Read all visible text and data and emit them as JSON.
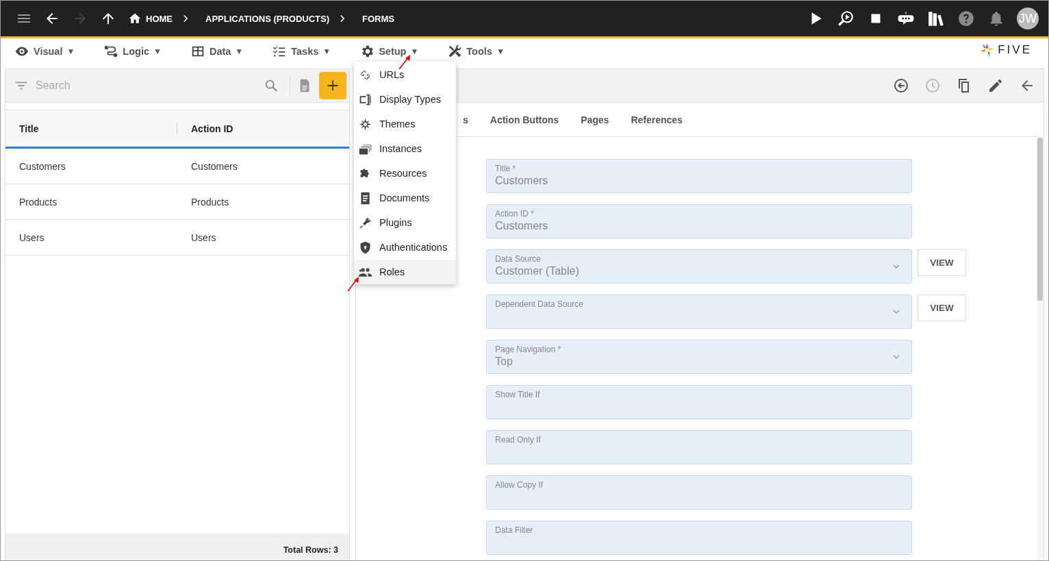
{
  "top_bar": {
    "breadcrumbs": [
      "HOME",
      "APPLICATIONS (PRODUCTS)",
      "FORMS"
    ],
    "avatar": "JW"
  },
  "menu_bar": {
    "items": [
      {
        "label": "Visual",
        "caret": "▼",
        "kind": "eye"
      },
      {
        "label": "Logic",
        "caret": "▼",
        "kind": "flow"
      },
      {
        "label": "Data",
        "caret": "▼",
        "kind": "table"
      },
      {
        "label": "Tasks",
        "caret": "▼",
        "kind": "tasks"
      },
      {
        "label": "Setup",
        "caret": "▼",
        "kind": "gear"
      },
      {
        "label": "Tools",
        "caret": "▼",
        "kind": "tools"
      }
    ],
    "logo": "FIVE"
  },
  "setup_menu": [
    {
      "label": "URLs",
      "kind": "link",
      "selected": false
    },
    {
      "label": "Display Types",
      "kind": "display",
      "selected": false
    },
    {
      "label": "Themes",
      "kind": "themes",
      "selected": false
    },
    {
      "label": "Instances",
      "kind": "instances",
      "selected": false
    },
    {
      "label": "Resources",
      "kind": "puzzle",
      "selected": false
    },
    {
      "label": "Documents",
      "kind": "document",
      "selected": false
    },
    {
      "label": "Plugins",
      "kind": "plug",
      "selected": false
    },
    {
      "label": "Authentications",
      "kind": "shield",
      "selected": false
    },
    {
      "label": "Roles",
      "kind": "people",
      "selected": true
    }
  ],
  "list_panel": {
    "search": {
      "placeholder": "Search"
    },
    "columns": [
      "Title",
      "Action ID"
    ],
    "rows": [
      [
        "Customers",
        "Customers"
      ],
      [
        "Products",
        "Products"
      ],
      [
        "Users",
        "Users"
      ]
    ],
    "footer": "Total Rows: 3"
  },
  "detail_panel": {
    "tabs": [
      "s",
      "Action Buttons",
      "Pages",
      "References"
    ],
    "fields": [
      {
        "label": "Title *",
        "value": "Customers",
        "kind": "text"
      },
      {
        "label": "Action ID *",
        "value": "Customers",
        "kind": "text"
      },
      {
        "label": "Data Source",
        "value": "Customer (Table)",
        "kind": "select",
        "button": "VIEW"
      },
      {
        "label": "Dependent Data Source",
        "kind": "select",
        "button": "VIEW"
      },
      {
        "label": "Page Navigation *",
        "value": "Top",
        "kind": "select"
      },
      {
        "label": "Show Title If",
        "kind": "text"
      },
      {
        "label": "Read Only If",
        "kind": "text"
      },
      {
        "label": "Allow Copy If",
        "kind": "text"
      },
      {
        "label": "Data Filter",
        "kind": "text"
      }
    ]
  }
}
